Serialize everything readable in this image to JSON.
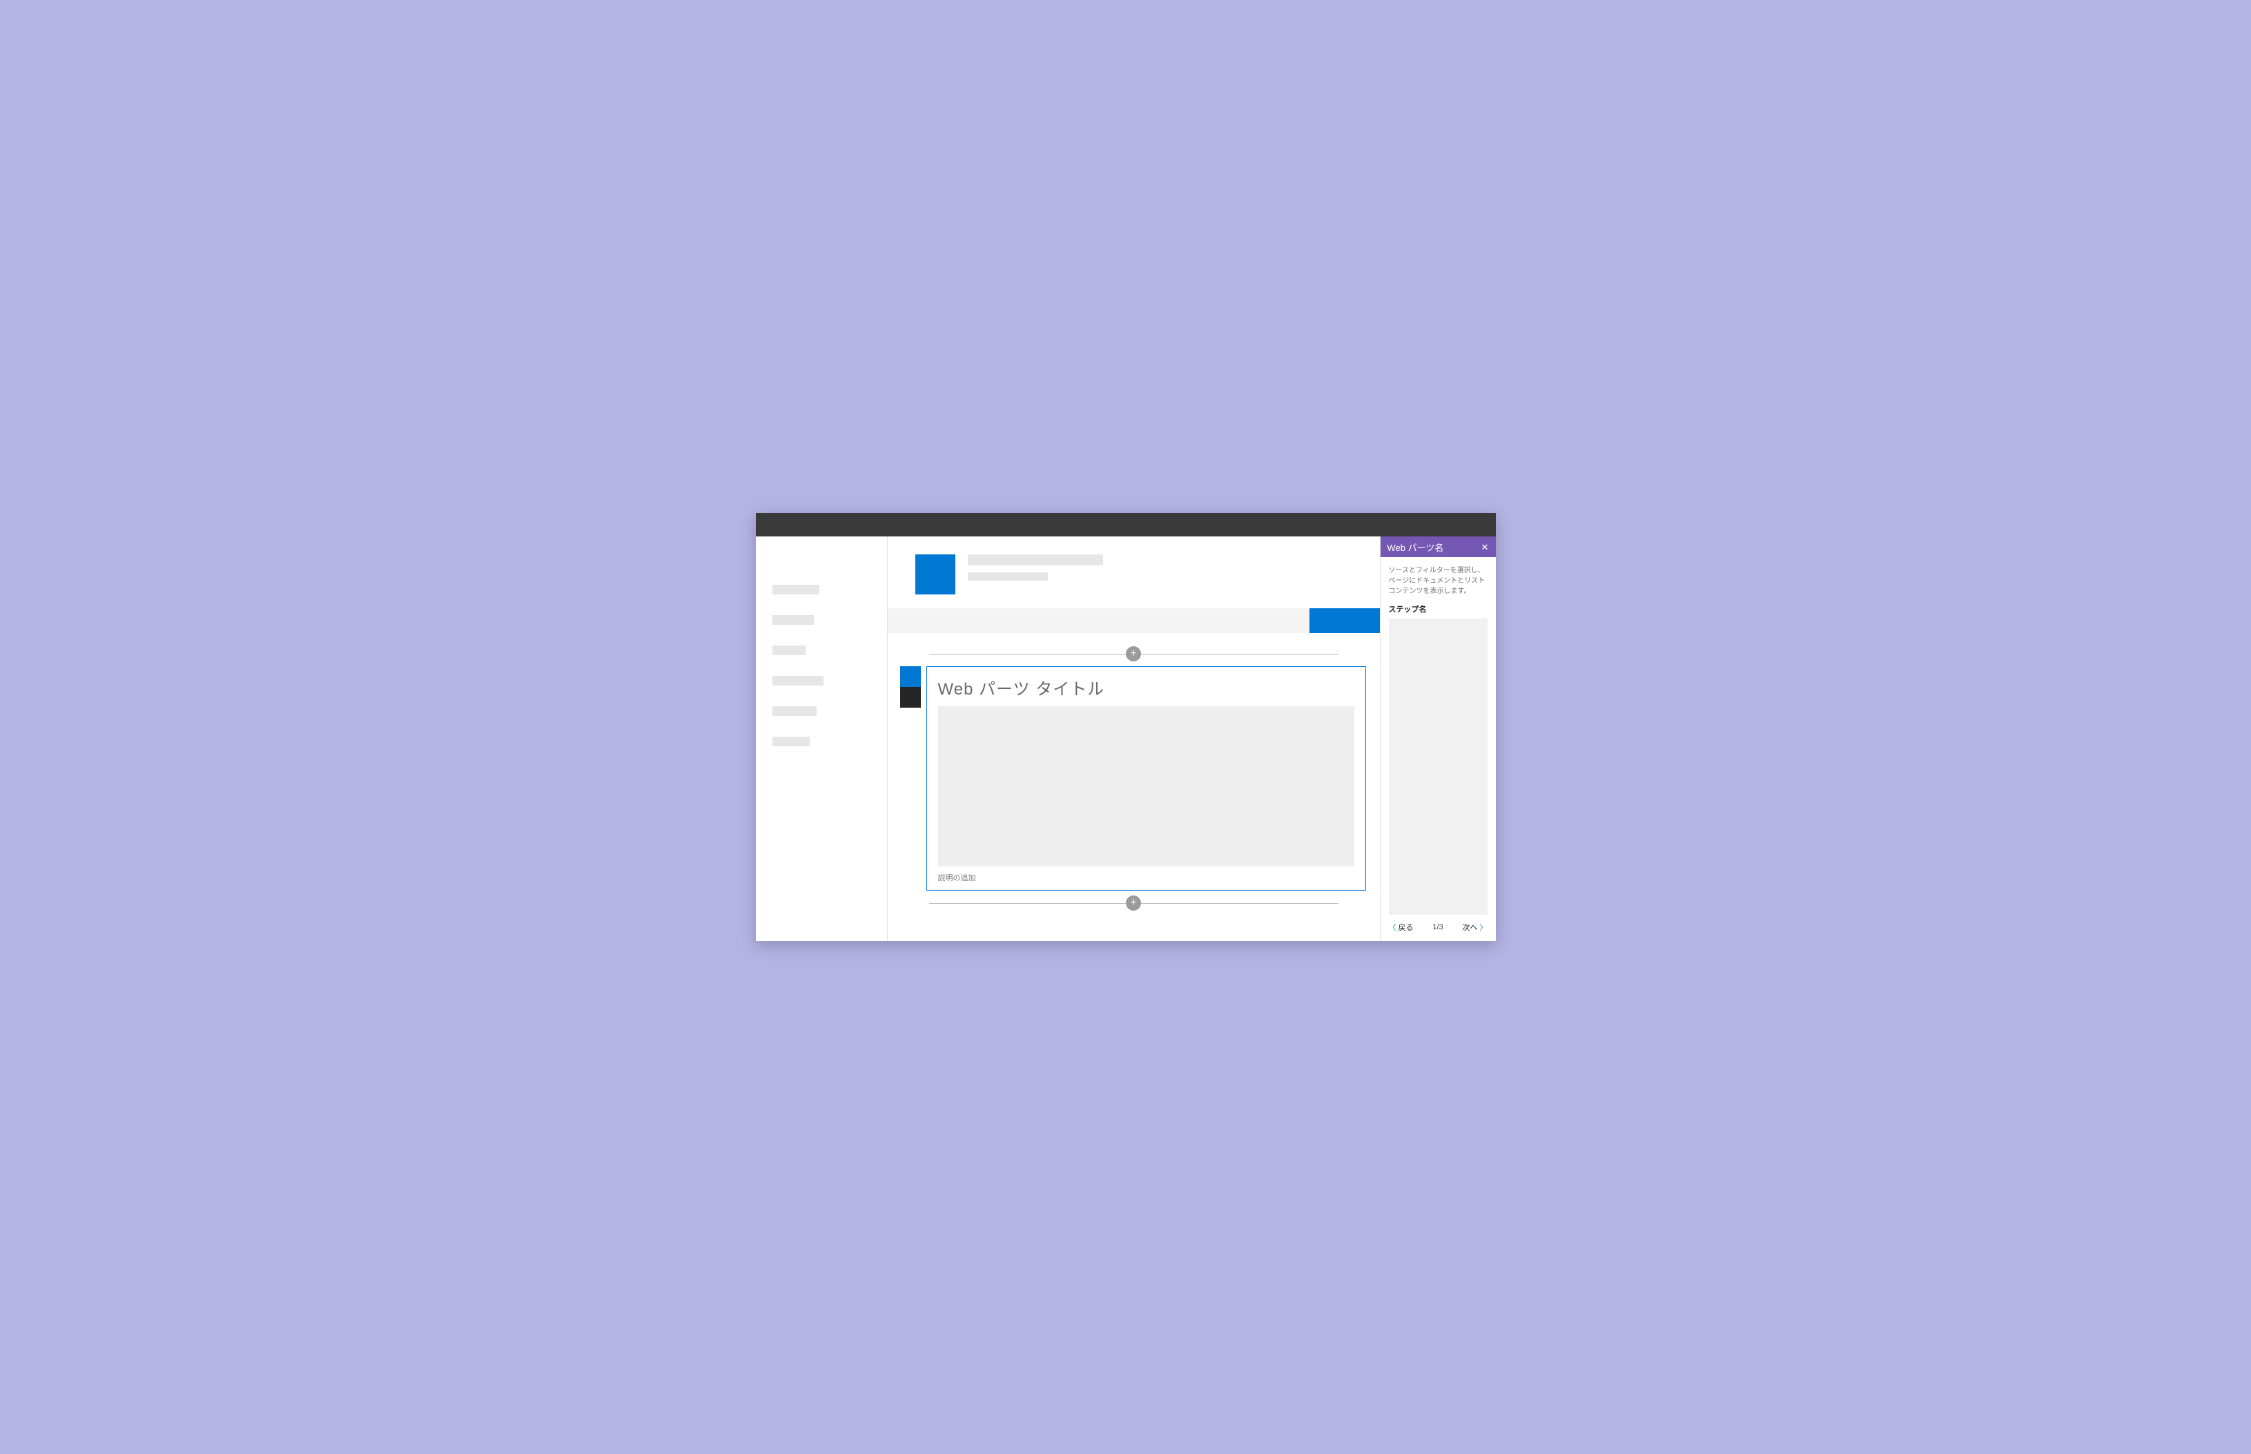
{
  "colors": {
    "accent": "#0078d4",
    "pane_accent": "#7558b3"
  },
  "webpart": {
    "title": "Web パーツ タイトル",
    "caption": "説明の追加"
  },
  "pane": {
    "header": "Web パーツ名",
    "description": "ソースとフィルターを選択し、ページにドキュメントとリストコンテンツを表示します。",
    "step_label": "ステップ名",
    "back": "戻る",
    "next": "次へ",
    "page_indicator": "1/3"
  }
}
